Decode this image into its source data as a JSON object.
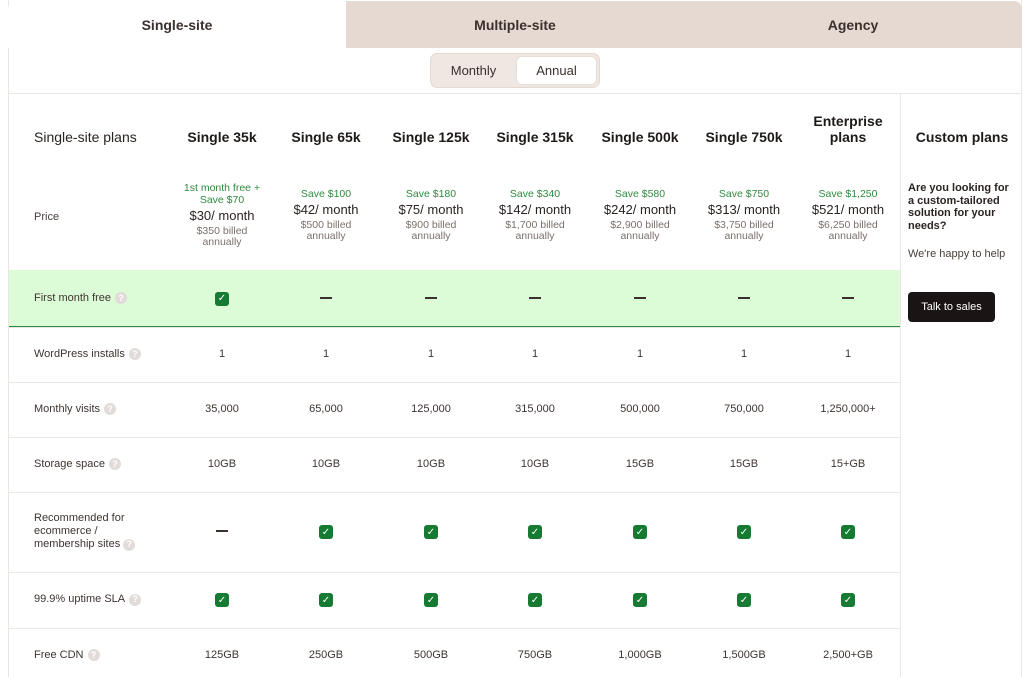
{
  "tabs": [
    {
      "label": "Single-site",
      "active": true
    },
    {
      "label": "Multiple-site",
      "active": false
    },
    {
      "label": "Agency",
      "active": false
    }
  ],
  "billing_toggle": {
    "monthly": "Monthly",
    "annual": "Annual",
    "selected": "Annual"
  },
  "table": {
    "plans_label": "Single-site plans",
    "price_label": "Price",
    "plans": [
      {
        "name": "Single 35k",
        "promo": "1st month free + Save $70",
        "price": "$30/ month",
        "billed": "$350 billed annually"
      },
      {
        "name": "Single 65k",
        "promo": "Save $100",
        "price": "$42/ month",
        "billed": "$500 billed annually"
      },
      {
        "name": "Single 125k",
        "promo": "Save $180",
        "price": "$75/ month",
        "billed": "$900 billed annually"
      },
      {
        "name": "Single 315k",
        "promo": "Save $340",
        "price": "$142/ month",
        "billed": "$1,700 billed annually"
      },
      {
        "name": "Single 500k",
        "promo": "Save $580",
        "price": "$242/ month",
        "billed": "$2,900 billed annually"
      },
      {
        "name": "Single 750k",
        "promo": "Save $750",
        "price": "$313/ month",
        "billed": "$3,750 billed annually"
      },
      {
        "name": "Enterprise plans",
        "promo": "Save $1,250",
        "price": "$521/ month",
        "billed": "$6,250 billed annually"
      }
    ],
    "rows": [
      {
        "label": "First month free",
        "values": [
          "check",
          "dash",
          "dash",
          "dash",
          "dash",
          "dash",
          "dash"
        ]
      },
      {
        "label": "WordPress installs",
        "values": [
          "1",
          "1",
          "1",
          "1",
          "1",
          "1",
          "1"
        ]
      },
      {
        "label": "Monthly visits",
        "values": [
          "35,000",
          "65,000",
          "125,000",
          "315,000",
          "500,000",
          "750,000",
          "1,250,000+"
        ]
      },
      {
        "label": "Storage space",
        "values": [
          "10GB",
          "10GB",
          "10GB",
          "10GB",
          "15GB",
          "15GB",
          "15+GB"
        ]
      },
      {
        "label": "Recommended for ecommerce / membership sites",
        "values": [
          "dash",
          "check",
          "check",
          "check",
          "check",
          "check",
          "check"
        ]
      },
      {
        "label": "99.9% uptime SLA",
        "values": [
          "check",
          "check",
          "check",
          "check",
          "check",
          "check",
          "check"
        ]
      },
      {
        "label": "Free CDN",
        "values": [
          "125GB",
          "250GB",
          "500GB",
          "750GB",
          "1,000GB",
          "1,500GB",
          "2,500+GB"
        ]
      }
    ]
  },
  "custom": {
    "title": "Custom plans",
    "question": "Are you looking for a custom-tailored solution for your needs?",
    "happy": "We're happy to help",
    "button": "Talk to sales"
  },
  "colors": {
    "accent_green": "#177a32",
    "highlight_row": "#dcfcd7",
    "tab_inactive": "#e6d9d1"
  },
  "icons": {
    "check": "check-icon",
    "help": "help-icon"
  }
}
